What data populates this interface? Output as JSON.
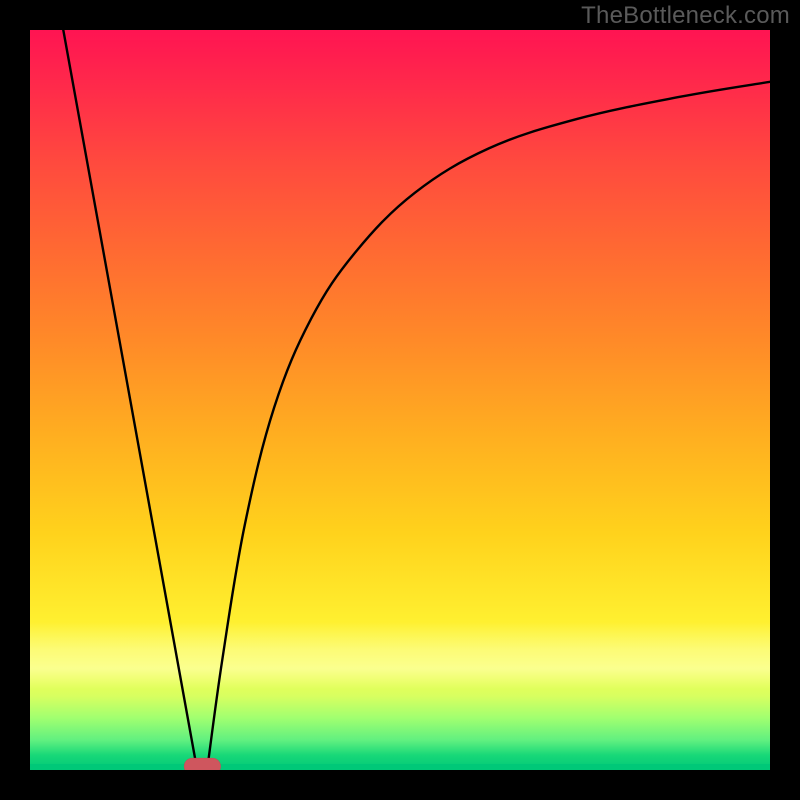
{
  "watermark": "TheBottleneck.com",
  "chart_data": {
    "type": "line",
    "title": "",
    "xlabel": "",
    "ylabel": "",
    "xlim": [
      0,
      100
    ],
    "ylim": [
      0,
      100
    ],
    "grid": false,
    "legend": false,
    "background_gradient": {
      "direction": "vertical",
      "stops": [
        {
          "pos": 0.0,
          "color": "#ff1452"
        },
        {
          "pos": 0.08,
          "color": "#ff2b4a"
        },
        {
          "pos": 0.18,
          "color": "#ff4a3e"
        },
        {
          "pos": 0.3,
          "color": "#ff6a32"
        },
        {
          "pos": 0.42,
          "color": "#ff8a28"
        },
        {
          "pos": 0.55,
          "color": "#ffaf20"
        },
        {
          "pos": 0.68,
          "color": "#ffd21c"
        },
        {
          "pos": 0.8,
          "color": "#fff030"
        },
        {
          "pos": 0.86,
          "color": "#f8ff4e"
        },
        {
          "pos": 0.9,
          "color": "#d8ff60"
        },
        {
          "pos": 0.93,
          "color": "#a0ff70"
        },
        {
          "pos": 0.96,
          "color": "#60f080"
        },
        {
          "pos": 0.98,
          "color": "#18d878"
        },
        {
          "pos": 1.0,
          "color": "#00c878"
        }
      ]
    },
    "series": [
      {
        "name": "left-arm",
        "stroke": "#000000",
        "points": [
          {
            "x": 4.5,
            "y": 100
          },
          {
            "x": 22.5,
            "y": 0.5
          }
        ]
      },
      {
        "name": "right-arm",
        "stroke": "#000000",
        "points": [
          {
            "x": 24.0,
            "y": 0.5
          },
          {
            "x": 26.0,
            "y": 15
          },
          {
            "x": 29.0,
            "y": 33
          },
          {
            "x": 33.0,
            "y": 49
          },
          {
            "x": 38.0,
            "y": 61
          },
          {
            "x": 44.0,
            "y": 70
          },
          {
            "x": 52.0,
            "y": 78
          },
          {
            "x": 62.0,
            "y": 84
          },
          {
            "x": 74.0,
            "y": 88
          },
          {
            "x": 88.0,
            "y": 91
          },
          {
            "x": 100.0,
            "y": 93
          }
        ]
      }
    ],
    "marker": {
      "shape": "pill",
      "color": "#cf565e",
      "x": 23.3,
      "y": 0.5,
      "width_pct": 4.9,
      "height_pct": 2.2
    }
  }
}
